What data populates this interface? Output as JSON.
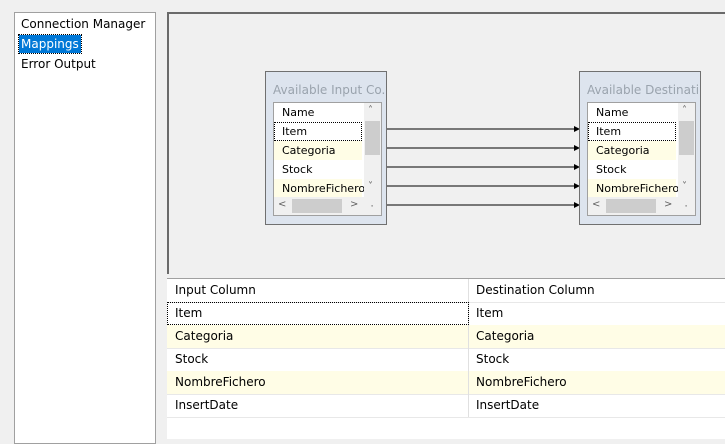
{
  "nav": {
    "items": [
      "Connection Manager",
      "Mappings",
      "Error Output"
    ],
    "selected": "Mappings"
  },
  "input_box": {
    "title": "Available Input Co...",
    "header": "Name",
    "rows": [
      "Item",
      "Categoria",
      "Stock",
      "NombreFichero"
    ]
  },
  "dest_box": {
    "title": "Available Destinati...",
    "header": "Name",
    "rows": [
      "Item",
      "Categoria",
      "Stock",
      "NombreFichero"
    ]
  },
  "grid": {
    "headers": [
      "Input Column",
      "Destination Column"
    ],
    "rows": [
      [
        "Item",
        "Item"
      ],
      [
        "Categoria",
        "Categoria"
      ],
      [
        "Stock",
        "Stock"
      ],
      [
        "NombreFichero",
        "NombreFichero"
      ],
      [
        "InsertDate",
        "InsertDate"
      ]
    ]
  }
}
